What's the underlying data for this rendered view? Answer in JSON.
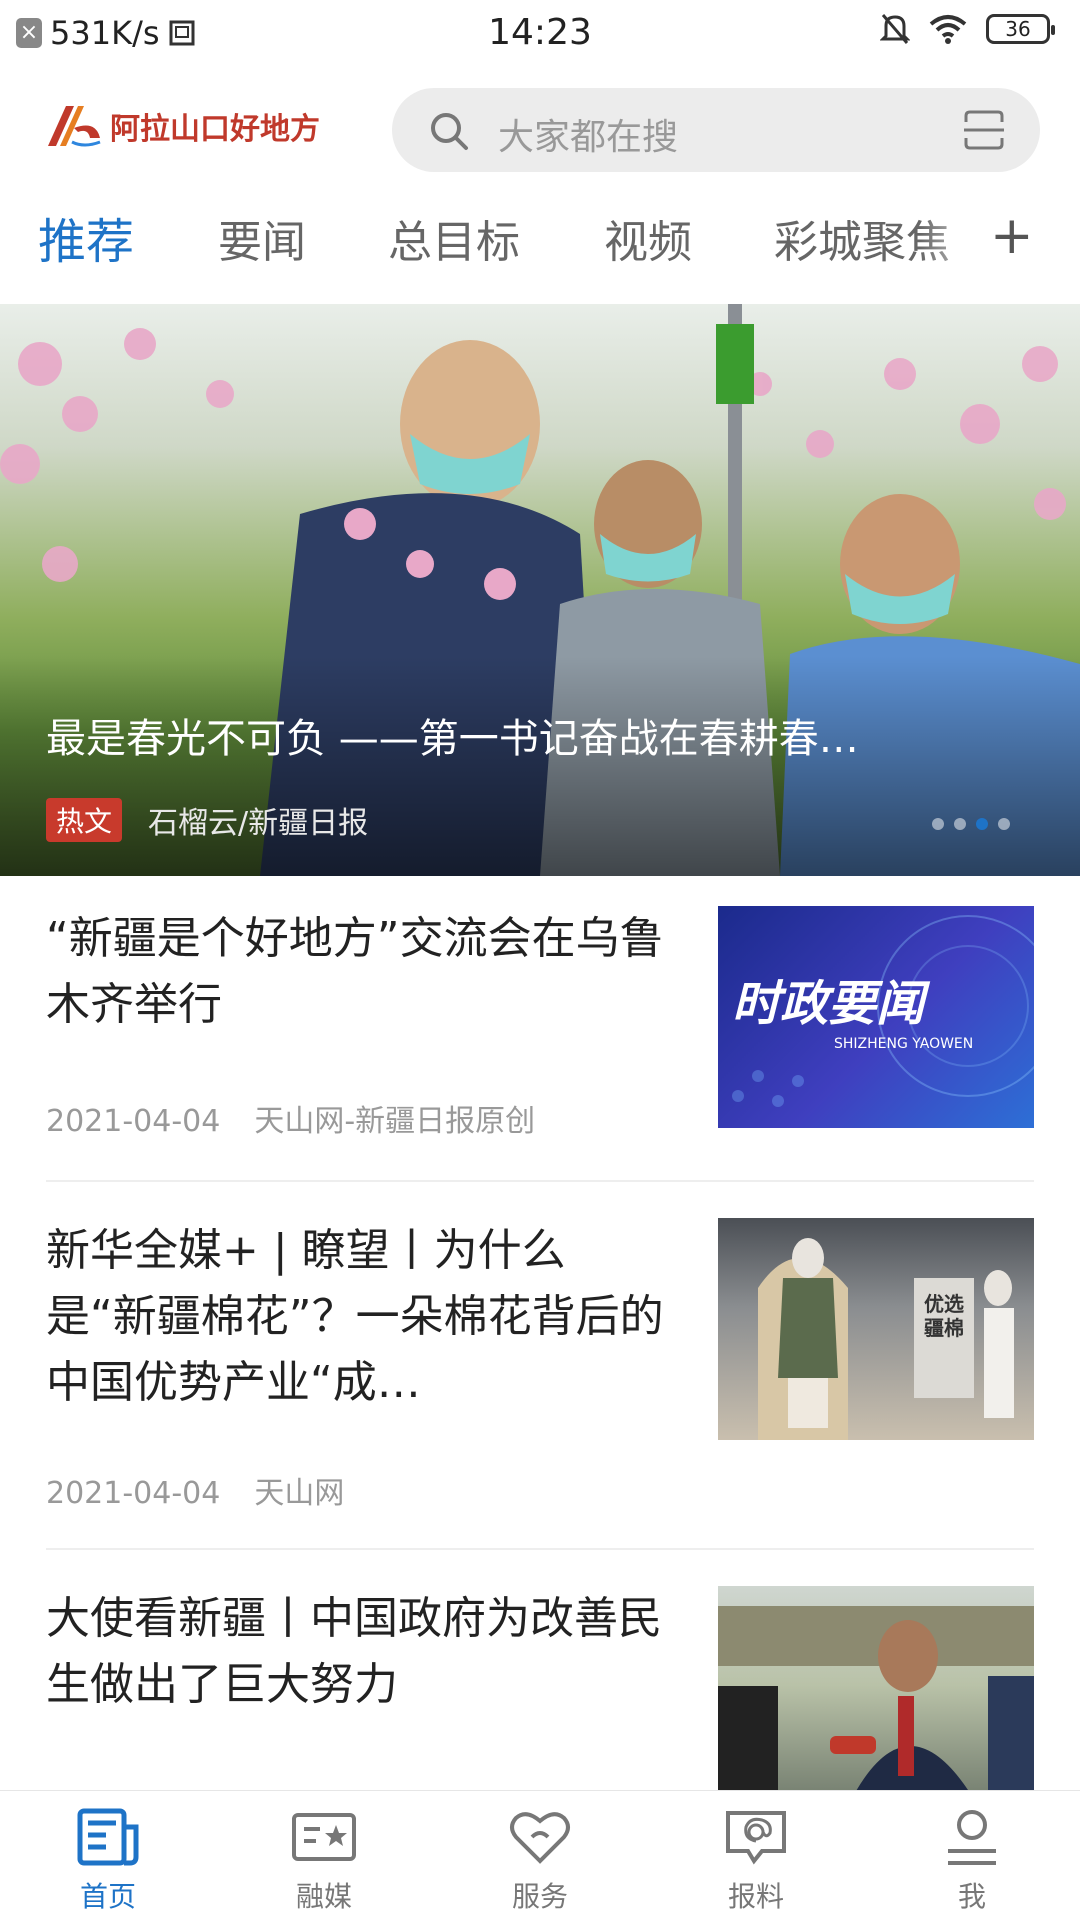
{
  "status_bar": {
    "network_speed": "531K/s",
    "time": "14:23",
    "battery": "36"
  },
  "header": {
    "app_name": "阿拉山口好地方",
    "search_placeholder": "大家都在搜"
  },
  "tabs": [
    {
      "label": "推荐",
      "active": true
    },
    {
      "label": "要闻",
      "active": false
    },
    {
      "label": "总目标",
      "active": false
    },
    {
      "label": "视频",
      "active": false
    },
    {
      "label": "彩城聚焦",
      "active": false
    }
  ],
  "hero": {
    "title": "最是春光不可负 ——第一书记奋战在春耕春…",
    "badge": "热文",
    "source": "石榴云/新疆日报"
  },
  "news": [
    {
      "title": "“新疆是个好地方”交流会在乌鲁木齐举行",
      "date": "2021-04-04",
      "source": "天山网-新疆日报原创",
      "thumb_title": "时政要闻",
      "thumb_subtitle": "SHIZHENG YAOWEN"
    },
    {
      "title": "新华全媒+ | 瞭望丨为什么是“新疆棉花”？一朵棉花背后的中国优势产业“成…",
      "date": "2021-04-04",
      "source": "天山网",
      "thumb_sign": "优选疆棉"
    },
    {
      "title": "大使看新疆丨中国政府为改善民生做出了巨大努力",
      "date": "",
      "source": ""
    }
  ],
  "bottom_nav": [
    {
      "label": "首页",
      "icon": "news-icon",
      "active": true
    },
    {
      "label": "融媒",
      "icon": "media-card-icon",
      "active": false
    },
    {
      "label": "服务",
      "icon": "heart-service-icon",
      "active": false
    },
    {
      "label": "报料",
      "icon": "report-chat-icon",
      "active": false
    },
    {
      "label": "我",
      "icon": "user-icon",
      "active": false
    }
  ],
  "colors": {
    "accent": "#1e73c7",
    "badge": "#c83a2c",
    "logo": "#c0392b"
  }
}
